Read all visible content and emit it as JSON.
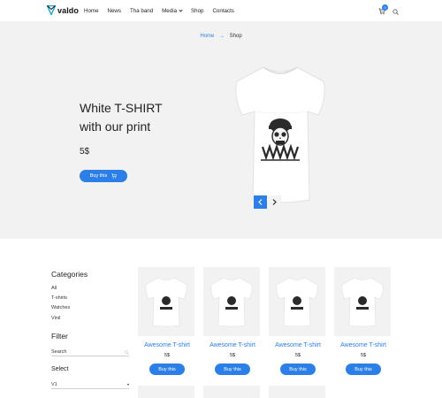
{
  "header": {
    "logo_text": "valdo",
    "nav": [
      "Home",
      "News",
      "Tha band",
      "Media",
      "Shop",
      "Contacts"
    ],
    "cart_count": "0"
  },
  "breadcrumb": {
    "home": "Home",
    "separator": "→",
    "current": "Shop"
  },
  "hero": {
    "title_line1": "White T-SHIRT",
    "title_line2": "with our print",
    "price": "5$",
    "button_label": "Buy this"
  },
  "sidebar": {
    "categories_title": "Categories",
    "categories": [
      "All",
      "T-shirts",
      "Watches",
      "Vinil"
    ],
    "filter_title": "Filter",
    "search_placeholder": "Search",
    "select_title": "Select",
    "select_value": "V1"
  },
  "products": [
    {
      "name": "Awesome T-shirt",
      "price": "5$",
      "button": "Buy this"
    },
    {
      "name": "Awesome T-shirt",
      "price": "5$",
      "button": "Buy this"
    },
    {
      "name": "Awesome T-shirt",
      "price": "5$",
      "button": "Buy this"
    },
    {
      "name": "Awesome T-shirt",
      "price": "5$",
      "button": "Buy this"
    }
  ],
  "colors": {
    "accent": "#2b7fe6",
    "hero_bg": "#f2f2f2"
  }
}
